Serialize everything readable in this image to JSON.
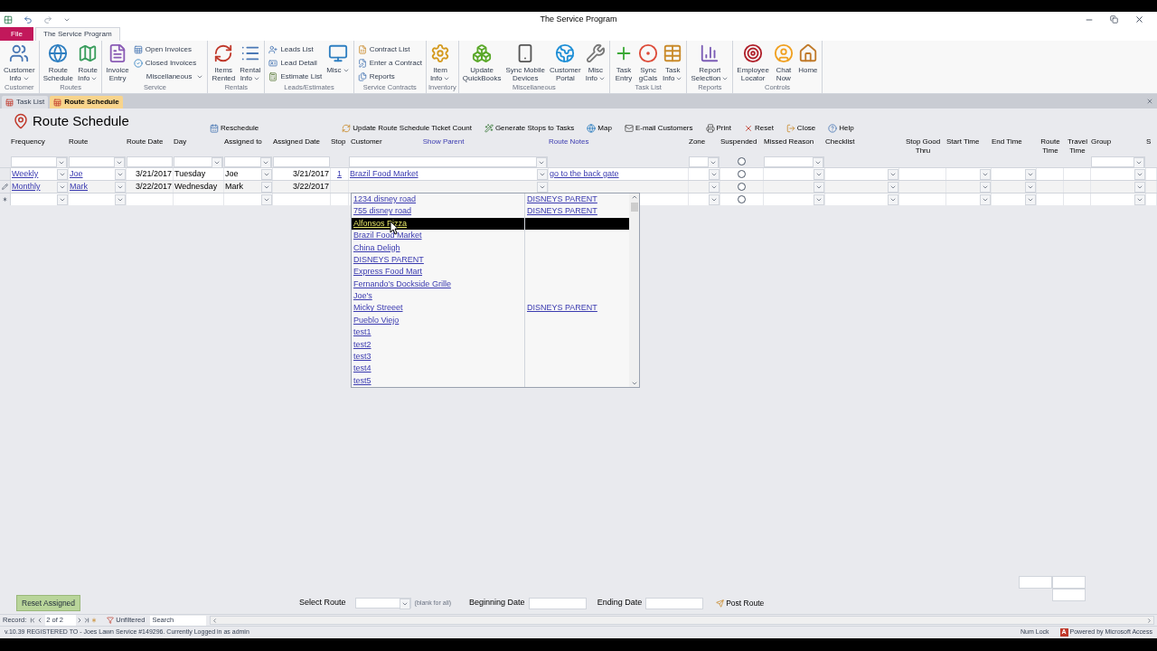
{
  "window": {
    "title": "The Service Program"
  },
  "ribbon_tabs": [
    {
      "label": "File",
      "kind": "file",
      "selected": false
    },
    {
      "label": "The Service Program",
      "kind": "tab",
      "selected": true
    }
  ],
  "ribbon_groups": [
    {
      "label": "Customer",
      "items": [
        {
          "kind": "large",
          "lines": [
            "Customer",
            "Info"
          ],
          "dropdown": true
        }
      ]
    },
    {
      "label": "Routes",
      "items": [
        {
          "kind": "large",
          "lines": [
            "Route",
            "Schedule"
          ],
          "dropdown": false
        },
        {
          "kind": "large",
          "lines": [
            "Route",
            "Info"
          ],
          "dropdown": true
        }
      ]
    },
    {
      "label": "Service",
      "items": [
        {
          "kind": "large",
          "lines": [
            "Invoice",
            "Entry"
          ],
          "dropdown": false
        },
        {
          "kind": "smalls",
          "entries": [
            {
              "label": "Open Invoices",
              "dropdown": false
            },
            {
              "label": "Closed Invoices",
              "dropdown": false
            },
            {
              "label": "Miscellaneous",
              "dropdown": true
            }
          ]
        }
      ]
    },
    {
      "label": "Rentals",
      "items": [
        {
          "kind": "large",
          "lines": [
            "Items",
            "Rented"
          ],
          "dropdown": false
        },
        {
          "kind": "large",
          "lines": [
            "Rental",
            "Info"
          ],
          "dropdown": true
        }
      ]
    },
    {
      "label": "Leads/Estimates",
      "items": [
        {
          "kind": "smalls",
          "entries": [
            {
              "label": "Leads List",
              "dropdown": false
            },
            {
              "label": "Lead Detail",
              "dropdown": false
            },
            {
              "label": "Estimate List",
              "dropdown": false
            }
          ]
        },
        {
          "kind": "large",
          "lines": [
            "Misc"
          ],
          "dropdown": true
        }
      ]
    },
    {
      "label": "Service Contracts",
      "items": [
        {
          "kind": "smalls",
          "entries": [
            {
              "label": "Contract List",
              "dropdown": false
            },
            {
              "label": "Enter a Contract",
              "dropdown": false
            },
            {
              "label": "Reports",
              "dropdown": false
            }
          ]
        }
      ]
    },
    {
      "label": "Inventory",
      "items": [
        {
          "kind": "large",
          "lines": [
            "Item",
            "Info"
          ],
          "dropdown": true
        }
      ]
    },
    {
      "label": "Miscellaneous",
      "items": [
        {
          "kind": "large",
          "lines": [
            "Update",
            "QuickBooks"
          ],
          "dropdown": false
        },
        {
          "kind": "large",
          "lines": [
            "Sync Mobile",
            "Devices"
          ],
          "dropdown": false
        },
        {
          "kind": "large",
          "lines": [
            "Customer",
            "Portal"
          ],
          "dropdown": false
        },
        {
          "kind": "large",
          "lines": [
            "Misc",
            "Info"
          ],
          "dropdown": true
        }
      ]
    },
    {
      "label": "Task List",
      "items": [
        {
          "kind": "large",
          "lines": [
            "Task",
            "Entry"
          ],
          "dropdown": false
        },
        {
          "kind": "large",
          "lines": [
            "Sync",
            "gCals"
          ],
          "dropdown": false
        },
        {
          "kind": "large",
          "lines": [
            "Task",
            "Info"
          ],
          "dropdown": true
        }
      ]
    },
    {
      "label": "Reports",
      "items": [
        {
          "kind": "large",
          "lines": [
            "Report",
            "Selection"
          ],
          "dropdown": true
        }
      ]
    },
    {
      "label": "Controls",
      "items": [
        {
          "kind": "large",
          "lines": [
            "Employee",
            "Locator"
          ],
          "dropdown": false
        },
        {
          "kind": "large",
          "lines": [
            "Chat",
            "Now"
          ],
          "dropdown": false
        },
        {
          "kind": "large",
          "lines": [
            "Home"
          ],
          "dropdown": false
        }
      ]
    }
  ],
  "doc_tabs": [
    {
      "label": "Task List",
      "selected": false
    },
    {
      "label": "Route Schedule",
      "selected": true
    }
  ],
  "form": {
    "title": "Route Schedule",
    "toolbar": [
      "Reschedule",
      "Update Route Schedule Ticket Count",
      "Generate Stops to Tasks",
      "Map",
      "E-mail Customers",
      "Print",
      "Reset",
      "Close",
      "Help"
    ]
  },
  "grid": {
    "columns": [
      {
        "header": "Frequency",
        "kind": "combo",
        "filter": {
          "kind": "combo"
        },
        "link": true
      },
      {
        "header": "Route",
        "kind": "combo",
        "filter": {
          "kind": "combo"
        },
        "link": true
      },
      {
        "header": "Route Date",
        "kind": "date",
        "filter": {
          "kind": "field"
        },
        "link": false
      },
      {
        "header": "Day",
        "kind": "text",
        "filter": {
          "kind": "combo"
        },
        "link": false
      },
      {
        "header": "Assigned to",
        "kind": "combo",
        "filter": {
          "kind": "combo"
        },
        "link": false
      },
      {
        "header": "Assigned Date",
        "kind": "date",
        "filter": {
          "kind": "field"
        },
        "link": false
      },
      {
        "header": "Stop",
        "kind": "center",
        "link": true
      },
      {
        "header": "Customer",
        "extra_header": "Show Parent",
        "kind": "combo",
        "filter": {
          "kind": "combo"
        },
        "link": true
      },
      {
        "header": "Route Notes",
        "header_link": true,
        "kind": "text",
        "link": true
      },
      {
        "header": "Zone",
        "kind": "combo",
        "filter": {
          "kind": "combo"
        }
      },
      {
        "header": "Suspended",
        "kind": "radio",
        "filter": {
          "kind": "radio"
        }
      },
      {
        "header": "Missed Reason",
        "kind": "combo",
        "filter": {
          "kind": "combo"
        }
      },
      {
        "header": "Checklist",
        "kind": "combo"
      },
      {
        "header": "Stop Good Thru",
        "kind": "text"
      },
      {
        "header": "Start Time",
        "kind": "combo"
      },
      {
        "header": "End Time",
        "kind": "combo"
      },
      {
        "header": "Route Time",
        "kind": "text"
      },
      {
        "header": "Travel Time",
        "kind": "text"
      },
      {
        "header": "Group",
        "kind": "combo",
        "filter": {
          "kind": "combo"
        }
      },
      {
        "header": "S",
        "kind": "text"
      }
    ],
    "rows": [
      {
        "suspended": false,
        "cells": [
          "Weekly",
          "Joe",
          "3/21/2017",
          "Tuesday",
          "Joe",
          "3/21/2017",
          "1",
          "Brazil Food Market",
          "go to the back gate"
        ]
      },
      {
        "record_selector": {
          "kind": "editing"
        },
        "suspended": false,
        "cells": [
          "Monthly",
          "Mark",
          "3/22/2017",
          "Wednesday",
          "Mark",
          "3/22/2017"
        ]
      },
      {
        "record_selector": {
          "kind": "new"
        },
        "suspended": false
      }
    ]
  },
  "dropdown": {
    "items": [
      {
        "name": "1234 disney road",
        "parent": "DISNEYS PARENT",
        "selected": false
      },
      {
        "name": "755 disney road",
        "parent": "DISNEYS PARENT",
        "selected": false
      },
      {
        "name": "Alfonsos Pizza",
        "selected": true
      },
      {
        "name": "Brazil Food Market",
        "selected": false
      },
      {
        "name": "China Deligh",
        "selected": false
      },
      {
        "name": "DISNEYS PARENT",
        "selected": false
      },
      {
        "name": "Express Food Mart",
        "selected": false
      },
      {
        "name": "Fernando’s Dockside Grille",
        "selected": false
      },
      {
        "name": "Joe's",
        "selected": false
      },
      {
        "name": "Micky Streeet",
        "parent": "DISNEYS PARENT",
        "selected": false
      },
      {
        "name": "Pueblo Viejo",
        "selected": false
      },
      {
        "name": "test1",
        "selected": false
      },
      {
        "name": "test2",
        "selected": false
      },
      {
        "name": "test3",
        "selected": false
      },
      {
        "name": "test4",
        "selected": false
      },
      {
        "name": "test5",
        "selected": false
      }
    ]
  },
  "bottom": {
    "reset_button": "Reset Assigned",
    "select_route": {
      "label": "Select Route",
      "hint": "(blank for all)"
    },
    "beginning_date": {
      "label": "Beginning Date"
    },
    "ending_date": {
      "label": "Ending Date"
    },
    "post_button": "Post Route"
  },
  "record_nav": {
    "label": "Record:",
    "position": "2 of 2",
    "filter": "Unfiltered",
    "search_placeholder": "Search"
  },
  "status_bar": {
    "text": "v.10.39 REGISTERED TO - Joes Lawn Service #149296. Currently Logged in as admin",
    "num_lock": "Num Lock",
    "access_badge": "A",
    "powered": "Powered by Microsoft Access"
  }
}
